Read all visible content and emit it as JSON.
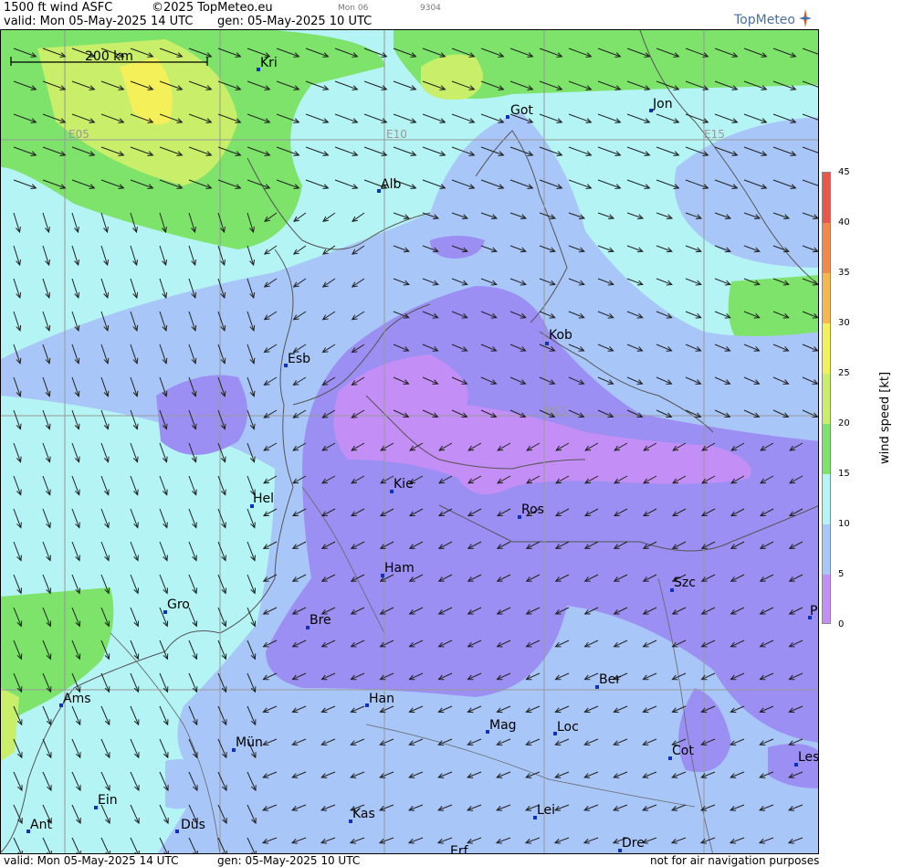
{
  "header": {
    "product": "1500 ft wind ASFC",
    "copyright": "©2025 TopMeteo.eu",
    "next_label": "Mon 06",
    "run_code": "9304",
    "valid": "valid:  Mon  05-May-2025  14 UTC",
    "gen": "gen: 05-May-2025 10 UTC",
    "logo": "TopMeteo"
  },
  "footer": {
    "valid": "valid:  Mon  05-May-2025  14 UTC",
    "gen": "gen: 05-May-2025 10 UTC",
    "disclaimer": "not for air navigation purposes"
  },
  "scale_bar": {
    "label": "200 km"
  },
  "grid_labels": {
    "e05": "E05",
    "e10": "E10",
    "e15": "E15",
    "n55": "N55"
  },
  "cities": {
    "kri": "Kri",
    "got": "Got",
    "jon": "Jon",
    "alb": "Alb",
    "kob": "Kob",
    "esb": "Esb",
    "kie": "Kie",
    "hel": "Hel",
    "ros": "Ros",
    "ham": "Ham",
    "szc": "Szc",
    "gro": "Gro",
    "bre": "Bre",
    "p": "P",
    "ber": "Ber",
    "ams": "Ams",
    "han": "Han",
    "mag": "Mag",
    "loc": "Loc",
    "mun": "Mün",
    "cot": "Cot",
    "les": "Les",
    "ein": "Ein",
    "kas": "Kas",
    "lei": "Lei",
    "ant": "Ant",
    "dus": "Düs",
    "dre": "Dre",
    "erf": "Erf"
  },
  "colorbar": {
    "title": "wind speed [kt]",
    "ticks": [
      "45",
      "40",
      "35",
      "30",
      "25",
      "20",
      "15",
      "10",
      "5",
      "0"
    ],
    "colors": [
      "#e8574c",
      "#f0894a",
      "#f6b84e",
      "#f3f05a",
      "#c8ee6a",
      "#7de36a",
      "#b4f4f4",
      "#a8c6f7",
      "#9b8ff3",
      "#c38ef5"
    ]
  }
}
